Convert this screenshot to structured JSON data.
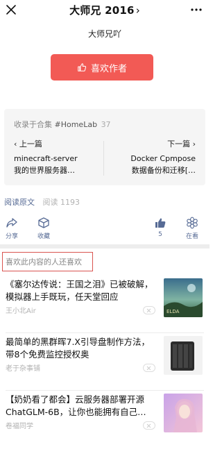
{
  "header": {
    "title": "大师兄 2016",
    "title_chevron": "›",
    "close_icon": "close-icon",
    "more_icon": "more-dots-icon"
  },
  "author": {
    "name": "大师兄吖",
    "like_button_label": "喜欢作者",
    "like_button_color": "#f25a55"
  },
  "collection": {
    "prefix": "收录于合集",
    "tag": "#HomeLab",
    "count": "37",
    "prev_label": "‹ 上一篇",
    "prev_title_line1": "minecraft-server",
    "prev_title_line2": "我的世界服务器…",
    "next_label": "下一篇 ›",
    "next_title_line1": "Docker Cpmpose",
    "next_title_line2": "数据备份和迁移[…"
  },
  "meta": {
    "read_original": "阅读原文",
    "reads_label": "阅读 1193"
  },
  "actions": {
    "share_label": "分享",
    "collect_label": "收藏",
    "like_count": "5",
    "looking_label": "在看",
    "accent_color": "#576b95"
  },
  "recommend_title": "喜欢此内容的人还喜欢",
  "recommendations": [
    {
      "title": "《塞尔达传说：王国之泪》已被破解，模拟器上手既玩，任天堂回应",
      "source": "王小北Air"
    },
    {
      "title": "最简单的黑群晖7.X引导盘制作方法，带8个免费监控授权奥",
      "source": "老于杂事铺"
    },
    {
      "title": "【奶奶看了都会】云服务器部署开源ChatGLM-6B，让你也能拥有自己…",
      "source": "卷福同学"
    }
  ]
}
